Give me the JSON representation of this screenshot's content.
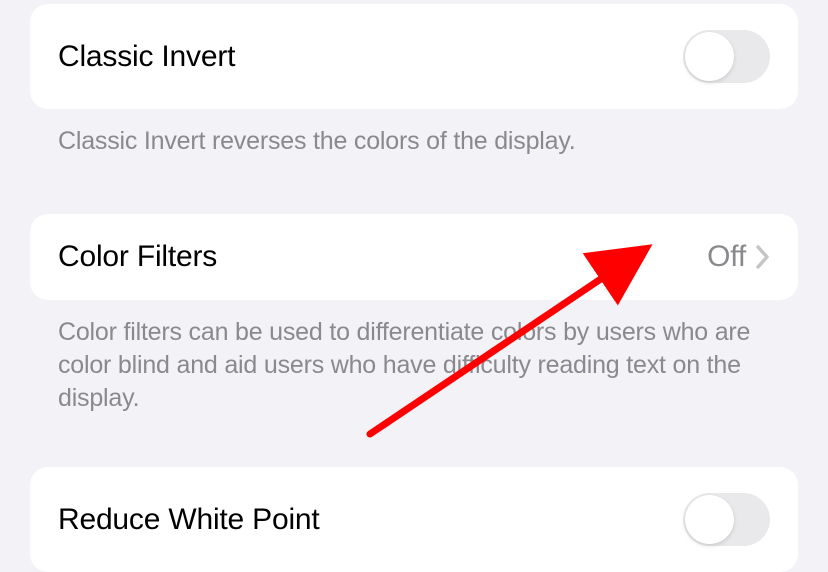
{
  "rows": {
    "classic_invert": {
      "title": "Classic Invert",
      "footer": "Classic Invert reverses the colors of the display."
    },
    "color_filters": {
      "title": "Color Filters",
      "value": "Off",
      "footer": "Color filters can be used to differentiate colors by users who are color blind and aid users who have difficulty reading text on the display."
    },
    "reduce_white_point": {
      "title": "Reduce White Point"
    }
  },
  "colors": {
    "arrow": "#ff0000"
  }
}
